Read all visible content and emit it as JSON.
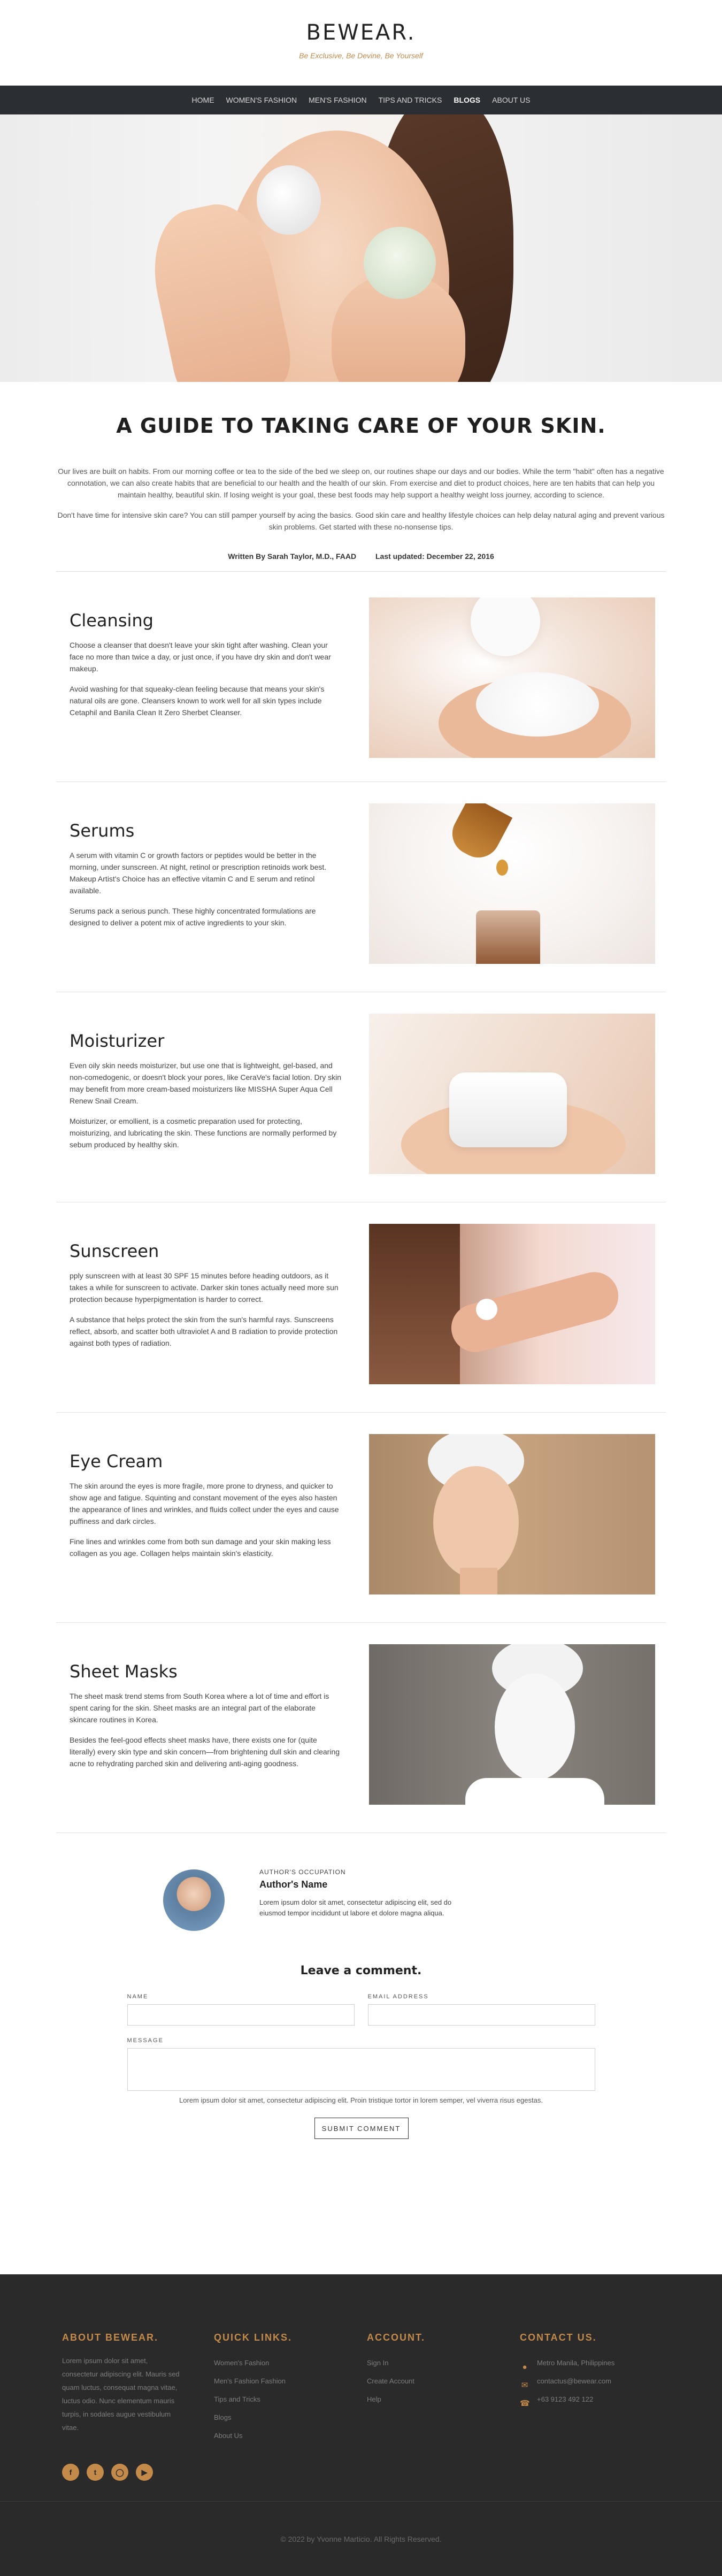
{
  "header": {
    "brand": "BEWEAR.",
    "tagline": "Be Exclusive, Be Devine, Be Yourself"
  },
  "nav": {
    "items": [
      "HOME",
      "WOMEN'S FASHION",
      "MEN'S FASHION",
      "TIPS AND TRICKS",
      "BLOGS",
      "ABOUT US"
    ],
    "active": "BLOGS"
  },
  "article": {
    "title": "A GUIDE TO TAKING CARE OF YOUR SKIN.",
    "intro_1": "Our lives are built on habits. From our morning coffee or tea to the side of the bed we sleep on, our routines shape our days and our bodies. While the term \"habit\" often has a negative connotation, we can also create habits that are beneficial to our health and the health of our skin. From exercise and diet to product choices, here are ten habits that can help you maintain healthy, beautiful skin. If losing weight is your goal, these best foods may help support a healthy weight loss journey, according to science.",
    "intro_2": "Don't have time for intensive skin care? You can still pamper yourself by acing the basics. Good skin care and healthy lifestyle choices can help delay natural aging and prevent various skin problems. Get started with these no-nonsense tips.",
    "author_line": "Written By Sarah Taylor, M.D., FAAD",
    "updated_line": "Last updated: December 22, 2016"
  },
  "sections": [
    {
      "title": "Cleansing",
      "p1": "Choose a cleanser that doesn't leave your skin tight after washing. Clean your face no more than twice a day, or just once, if you have dry skin and don't wear makeup.",
      "p2": "Avoid washing for that squeaky-clean feeling because that means your skin's natural oils are gone. Cleansers known to work well for all skin types include Cetaphil and Banila Clean It Zero Sherbet Cleanser."
    },
    {
      "title": "Serums",
      "p1": "A serum with vitamin C or growth factors or peptides would be better in the morning, under sunscreen. At night, retinol or prescription retinoids work best. Makeup Artist's Choice has an effective vitamin C and E serum and retinol available.",
      "p2": "Serums pack a serious punch. These highly concentrated formulations are designed to deliver a potent mix of active ingredients to your skin."
    },
    {
      "title": "Moisturizer",
      "p1": "Even oily skin needs moisturizer, but use one that is lightweight, gel-based, and non-comedogenic, or doesn't block your pores, like CeraVe's facial lotion. Dry skin may benefit from more cream-based moisturizers like MISSHA Super Aqua Cell Renew Snail Cream.",
      "p2": "Moisturizer, or emollient, is a cosmetic preparation used for protecting, moisturizing, and lubricating the skin. These functions are normally performed by sebum produced by healthy skin."
    },
    {
      "title": "Sunscreen",
      "p1": "pply sunscreen with at least 30 SPF 15 minutes before heading outdoors, as it takes a while for sunscreen to activate. Darker skin tones actually need more sun protection because hyperpigmentation is harder to correct.",
      "p2": "A substance that helps protect the skin from the sun's harmful rays. Sunscreens reflect, absorb, and scatter both ultraviolet A and B radiation to provide protection against both types of radiation."
    },
    {
      "title": "Eye Cream",
      "p1": "The skin around the eyes is more fragile, more prone to dryness, and quicker to show age and fatigue. Squinting and constant movement of the eyes also hasten the appearance of lines and wrinkles, and fluids collect under the eyes and cause puffiness and dark circles.",
      "p2": "Fine lines and wrinkles come from both sun damage and your skin making less collagen as you age. Collagen helps maintain skin's elasticity."
    },
    {
      "title": "Sheet Masks",
      "p1": "The sheet mask trend stems from South Korea where a lot of time and effort is spent caring for the skin. Sheet masks are an integral part of the elaborate skincare routines in Korea.",
      "p2": "Besides the feel-good effects sheet masks have, there exists one for (quite literally) every skin type and skin concern—from brightening dull skin and clearing acne to rehydrating parched skin and delivering anti-aging goodness."
    }
  ],
  "author": {
    "occupation": "AUTHOR'S OCCUPATION",
    "name": "Author's Name",
    "bio": "Lorem ipsum dolor sit amet, consectetur adipiscing elit, sed do eiusmod tempor incididunt ut labore et dolore magna aliqua."
  },
  "comment": {
    "title": "Leave a comment.",
    "name_label": "NAME",
    "email_label": "EMAIL ADDRESS",
    "message_label": "MESSAGE",
    "note": "Lorem ipsum dolor sit amet, consectetur adipiscing elit. Proin tristique tortor in lorem semper, vel viverra risus egestas.",
    "submit_label": "SUBMIT COMMENT"
  },
  "footer": {
    "about_title": "ABOUT BEWEAR.",
    "about_text": "Lorem ipsum dolor sit amet, consectetur adipiscing elit. Mauris sed quam luctus, consequat magna vitae, luctus odio. Nunc elementum mauris turpis, in sodales augue vestibulum vitae.",
    "links_title": "QUICK LINKS.",
    "links": [
      "Women's Fashion",
      "Men's Fashion Fashion",
      "Tips and Tricks",
      "Blogs",
      "About Us"
    ],
    "account_title": "ACCOUNT.",
    "account": [
      "Sign In",
      "Create Account",
      "Help"
    ],
    "contact_title": "CONTACT US.",
    "contact": {
      "location": "Metro Manila, Philippines",
      "email": "contactus@bewear.com",
      "phone": "+63 9123 492 122"
    },
    "social_icons": [
      "facebook-icon",
      "twitter-icon",
      "instagram-icon",
      "youtube-icon"
    ],
    "copyright": "© 2022 by Yvonne Marticio. All Rights Reserved."
  },
  "colors": {
    "accent": "#c48a4a",
    "nav_bg": "#2b2e33",
    "footer_bg": "#2a2a2a"
  }
}
